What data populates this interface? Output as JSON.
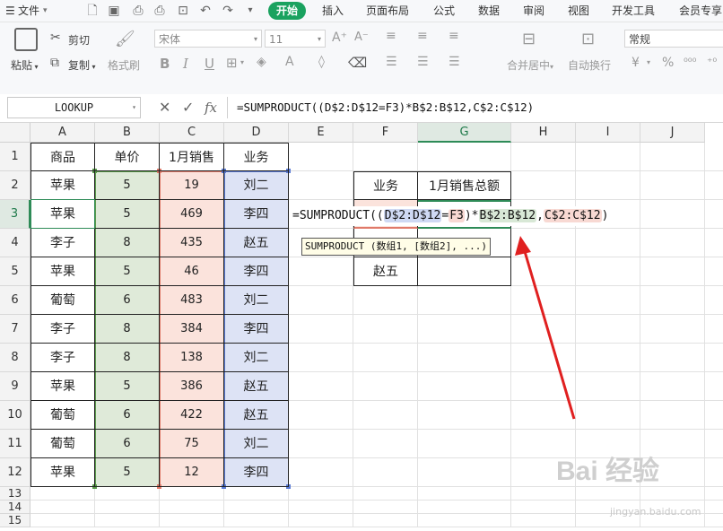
{
  "menubar": {
    "file": "文件",
    "tabs": [
      "开始",
      "插入",
      "页面布局",
      "公式",
      "数据",
      "审阅",
      "视图",
      "开发工具",
      "会员专享"
    ],
    "active_tab": "开始"
  },
  "ribbon": {
    "paste": "粘贴",
    "cut": "剪切",
    "copy": "复制",
    "format_painter": "格式刷",
    "font_name": "宋体",
    "font_size": "11",
    "bold": "B",
    "italic": "I",
    "underline": "U",
    "merge_center": "合并居中",
    "wrap_text": "自动换行",
    "number_format": "常规",
    "currency": "¥",
    "percent": "%"
  },
  "formula_bar": {
    "name_box": "LOOKUP",
    "fx": "fx",
    "formula": "=SUMPRODUCT((D$2:D$12=F3)*B$2:B$12,C$2:C$12)"
  },
  "grid": {
    "columns": [
      "A",
      "B",
      "C",
      "D",
      "E",
      "F",
      "G",
      "H",
      "I",
      "J"
    ],
    "rows": [
      "1",
      "2",
      "3",
      "4",
      "5",
      "6",
      "7",
      "8",
      "9",
      "10",
      "11",
      "12",
      "13",
      "14",
      "15"
    ],
    "headers": [
      "商品",
      "单价",
      "1月销售",
      "业务"
    ],
    "data": [
      [
        "苹果",
        "5",
        "19",
        "刘二"
      ],
      [
        "苹果",
        "5",
        "469",
        "李四"
      ],
      [
        "李子",
        "8",
        "435",
        "赵五"
      ],
      [
        "苹果",
        "5",
        "46",
        "李四"
      ],
      [
        "葡萄",
        "6",
        "483",
        "刘二"
      ],
      [
        "李子",
        "8",
        "384",
        "李四"
      ],
      [
        "李子",
        "8",
        "138",
        "刘二"
      ],
      [
        "苹果",
        "5",
        "386",
        "赵五"
      ],
      [
        "葡萄",
        "6",
        "422",
        "赵五"
      ],
      [
        "葡萄",
        "6",
        "75",
        "刘二"
      ],
      [
        "苹果",
        "5",
        "12",
        "李四"
      ]
    ],
    "summary": {
      "header_f": "业务",
      "header_g": "1月销售总额",
      "f5": "赵五"
    }
  },
  "cell_formula": {
    "prefix": "=SUMPRODUCT((",
    "ref1": "D$2:D$12",
    "eq": "=",
    "ref2": "F3",
    "mid": ")*",
    "ref3": "B$2:B$12",
    "comma": ",",
    "ref4": "C$2:C$12",
    "suffix": ")"
  },
  "tooltip": "SUMPRODUCT (数组1, [数组2], ...)",
  "watermark": "Bai 经验",
  "watermark_url": "jingyan.baidu.com",
  "colors": {
    "accent": "#1aa25f",
    "ref_blue": "#cfd9f3",
    "ref_red": "#f8d9d3",
    "ref_green": "#d8e8d6",
    "arrow": "#e02020"
  }
}
